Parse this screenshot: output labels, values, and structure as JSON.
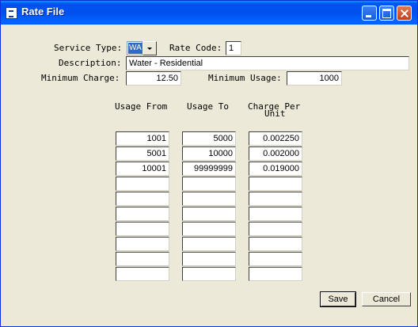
{
  "window": {
    "title": "Rate File"
  },
  "form": {
    "service_type_label": "Service Type:",
    "service_type_value": "WA",
    "rate_code_label": "Rate Code:",
    "rate_code_value": "1",
    "description_label": "Description:",
    "description_value": "Water - Residential",
    "min_charge_label": "Minimum Charge:",
    "min_charge_value": "12.50",
    "min_usage_label": "Minimum Usage:",
    "min_usage_value": "1000"
  },
  "table": {
    "col_usage_from": "Usage From",
    "col_usage_to": "Usage To",
    "col_charge_line1": "Charge Per",
    "col_charge_line2": "Unit",
    "rows": [
      {
        "from": "1001",
        "to": "5000",
        "charge": "0.002250"
      },
      {
        "from": "5001",
        "to": "10000",
        "charge": "0.002000"
      },
      {
        "from": "10001",
        "to": "99999999",
        "charge": "0.019000"
      },
      {
        "from": "",
        "to": "",
        "charge": ""
      },
      {
        "from": "",
        "to": "",
        "charge": ""
      },
      {
        "from": "",
        "to": "",
        "charge": ""
      },
      {
        "from": "",
        "to": "",
        "charge": ""
      },
      {
        "from": "",
        "to": "",
        "charge": ""
      },
      {
        "from": "",
        "to": "",
        "charge": ""
      },
      {
        "from": "",
        "to": "",
        "charge": ""
      }
    ]
  },
  "buttons": {
    "save": "Save",
    "cancel": "Cancel"
  }
}
